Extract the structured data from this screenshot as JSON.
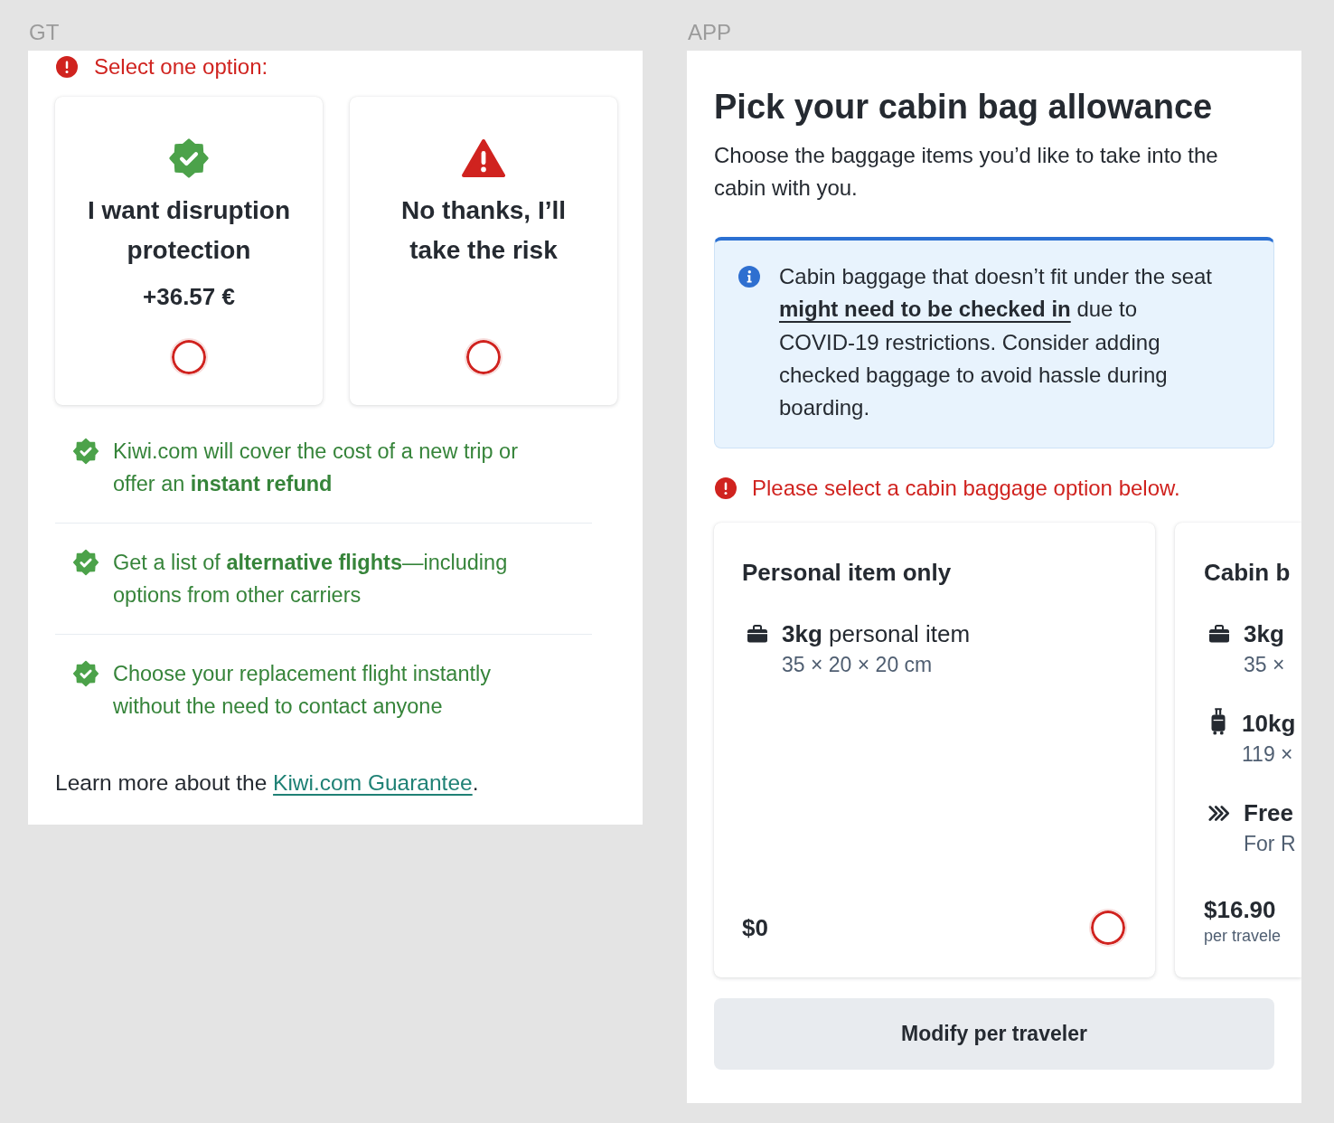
{
  "gt_panel": {
    "label": "GT",
    "error": "Select one option:",
    "options": [
      {
        "kind": "protection",
        "title": "I want disruption protection",
        "price": "+36.57 €",
        "selected": false
      },
      {
        "kind": "no_protection",
        "title": "No thanks, I’ll take the risk",
        "selected": false
      }
    ],
    "benefits": [
      "Kiwi.com will cover the cost of a new trip or offer an **instant refund**",
      "Get a list of **alternative flights**—including options from other carriers",
      "Choose your replacement flight instantly without the need to contact anyone"
    ],
    "footer": {
      "before": "Learn more about the ",
      "link": "Kiwi.com Guarantee",
      "after": "."
    }
  },
  "app_panel": {
    "label": "APP",
    "title": "Pick your cabin bag allowance",
    "subtitle": "Choose the baggage items you’d like to take into the cabin with you.",
    "info": {
      "before": "Cabin baggage that doesn’t fit under the seat ",
      "link": "might need to be checked in",
      "after": " due to COVID-19 restrictions. Consider adding checked baggage to avoid hassle during boarding."
    },
    "error": "Please select a cabin baggage option below.",
    "cards": [
      {
        "title": "Personal item only",
        "items": [
          {
            "kind": "personal",
            "name": "3kg",
            "detail": "personal item",
            "size": "35 × 20 × 20 cm"
          }
        ],
        "price": "$0",
        "selected": false
      },
      {
        "title": "Cabin b",
        "items": [
          {
            "kind": "personal",
            "name": "3kg",
            "size": "35 ×"
          },
          {
            "kind": "cabin",
            "name": "10kg",
            "size": "119 ×"
          },
          {
            "kind": "priority",
            "name": "Free",
            "size": "For R"
          }
        ],
        "price": "$16.90",
        "price_note": "per travele"
      }
    ],
    "button": "Modify per traveler"
  }
}
